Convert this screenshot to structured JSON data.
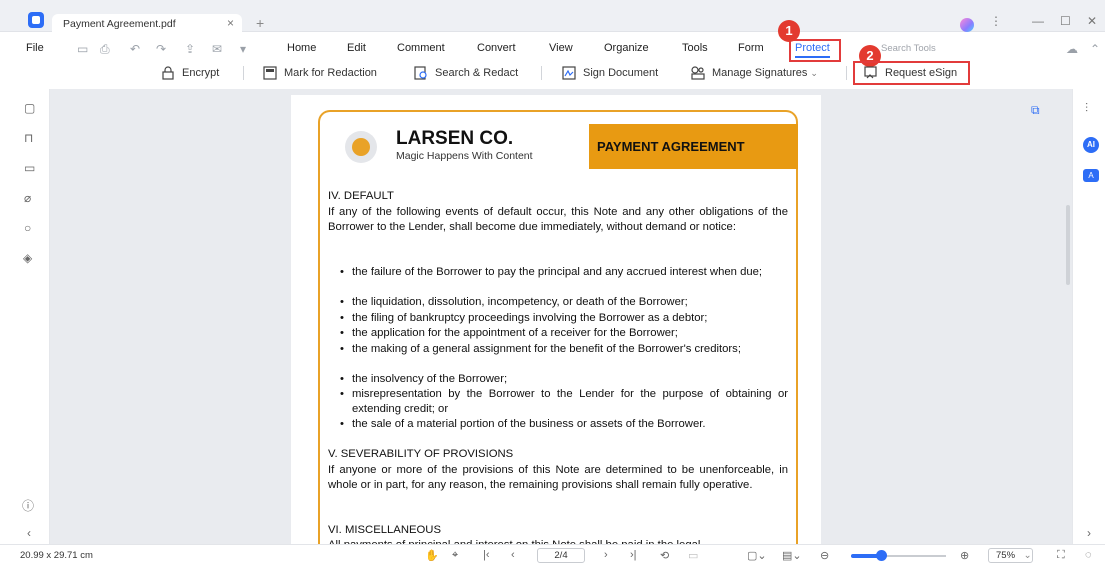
{
  "window": {
    "tab_title": "Payment Agreement.pdf",
    "tab_close": "×",
    "tab_add": "+",
    "more": "⋮",
    "minimize": "—",
    "maximize": "☐",
    "close": "✕"
  },
  "menu": {
    "file": "File",
    "items": [
      "Home",
      "Edit",
      "Comment",
      "Convert",
      "View",
      "Organize",
      "Tools",
      "Form",
      "Protect"
    ],
    "active": "Protect",
    "search_placeholder": "Search Tools"
  },
  "annotations": {
    "badge1": "1",
    "badge2": "2"
  },
  "protect_toolbar": {
    "encrypt": "Encrypt",
    "mark_redaction": "Mark for Redaction",
    "search_redact": "Search & Redact",
    "sign_document": "Sign Document",
    "manage_signatures": "Manage Signatures",
    "request_esign": "Request eSign"
  },
  "document": {
    "company": "LARSEN CO.",
    "tagline": "Magic Happens With Content",
    "doc_title": "PAYMENT AGREEMENT",
    "sec4_heading": "IV. DEFAULT",
    "sec4_intro": "If any of the following events of default occur, this Note and any other obligations of the Borrower to the Lender, shall become due immediately, without demand or notice:",
    "bullets": [
      "the failure of the Borrower to pay the principal and any accrued interest when due;",
      "the liquidation, dissolution, incompetency, or death of the Borrower;",
      "the filing of bankruptcy proceedings involving the Borrower as a debtor;",
      "the application for the appointment of a receiver for the Borrower;",
      "the making of a general assignment for the benefit of the Borrower's creditors;",
      "the insolvency of the Borrower;",
      "misrepresentation by the Borrower to the Lender for the purpose of obtaining or extending credit; or",
      "the sale of a material portion of the business or assets of the Borrower."
    ],
    "sec5_heading": "V. SEVERABILITY OF PROVISIONS",
    "sec5_text": "If anyone or more of the provisions of this Note are determined to be unenforceable, in whole or in part, for any reason, the remaining provisions shall remain fully operative.",
    "sec6_heading": "VI. MISCELLANEOUS",
    "sec6_text": "All payments of principal and interest on this Note shall be paid in the legal"
  },
  "status": {
    "dimensions": "20.99 x 29.71 cm",
    "page": "2/4",
    "zoom": "75%",
    "zoom_fraction": 0.32
  },
  "colors": {
    "accent": "#2d6df6",
    "brand_orange": "#e89a12",
    "highlight_red": "#e23b3b"
  }
}
